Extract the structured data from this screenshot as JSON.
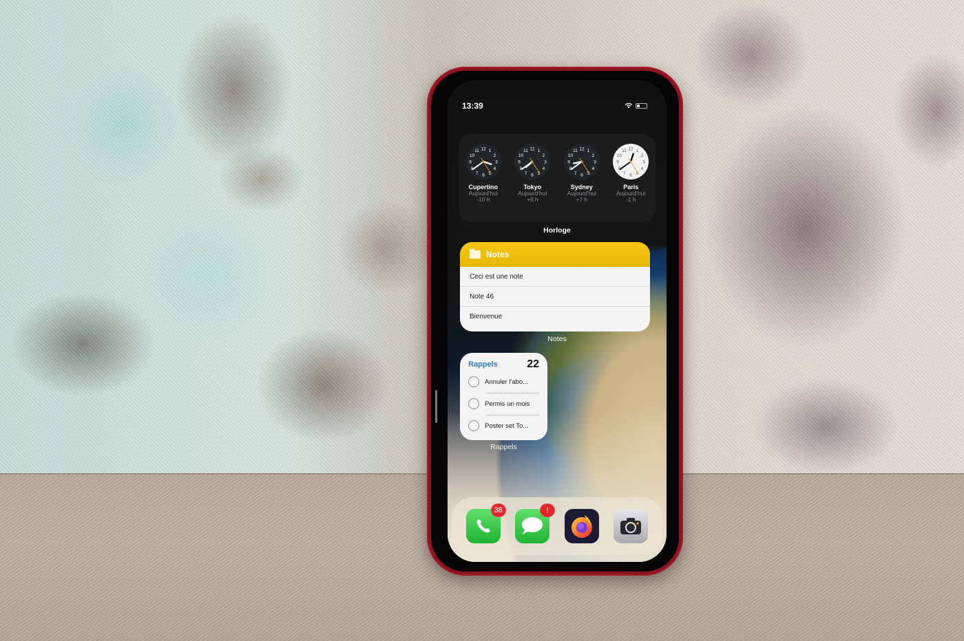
{
  "status_bar": {
    "time": "13:39",
    "icons": [
      "wifi-icon",
      "battery-icon"
    ]
  },
  "clock_widget": {
    "caption": "Horloge",
    "clocks": [
      {
        "city": "Cupertino",
        "day": "Aujourd'hui",
        "offset": "-10 h",
        "theme": "dark",
        "hour": 3.6,
        "minute": 39
      },
      {
        "city": "Tokyo",
        "day": "Aujourd'hui",
        "offset": "+6 h",
        "theme": "dark",
        "hour": 7.6,
        "minute": 39
      },
      {
        "city": "Sydney",
        "day": "Aujourd'hui",
        "offset": "+7 h",
        "theme": "dark",
        "hour": 8.6,
        "minute": 39
      },
      {
        "city": "Paris",
        "day": "Aujourd'hui",
        "offset": "-1 h",
        "theme": "light",
        "hour": 0.6,
        "minute": 39
      }
    ]
  },
  "notes_widget": {
    "title": "Notes",
    "caption": "Notes",
    "icon": "folder-icon",
    "items": [
      "Ceci est une note",
      "Note 46",
      "Bienvenue"
    ],
    "accent_color": "#f2c10f"
  },
  "reminders_widget": {
    "title": "Rappels",
    "count": "22",
    "caption": "Rappels",
    "accent_color": "#3478c6",
    "items": [
      "Annuler l'abo...",
      "Permis un mois",
      "Poster set To..."
    ]
  },
  "dock": {
    "apps": [
      {
        "name": "Phone",
        "icon": "phone-icon",
        "badge": "38"
      },
      {
        "name": "Messages",
        "icon": "messages-icon",
        "badge": "!"
      },
      {
        "name": "Firefox",
        "icon": "firefox-icon",
        "badge": null
      },
      {
        "name": "Camera",
        "icon": "camera-icon",
        "badge": null
      }
    ],
    "badge_color": "#e0262a"
  }
}
